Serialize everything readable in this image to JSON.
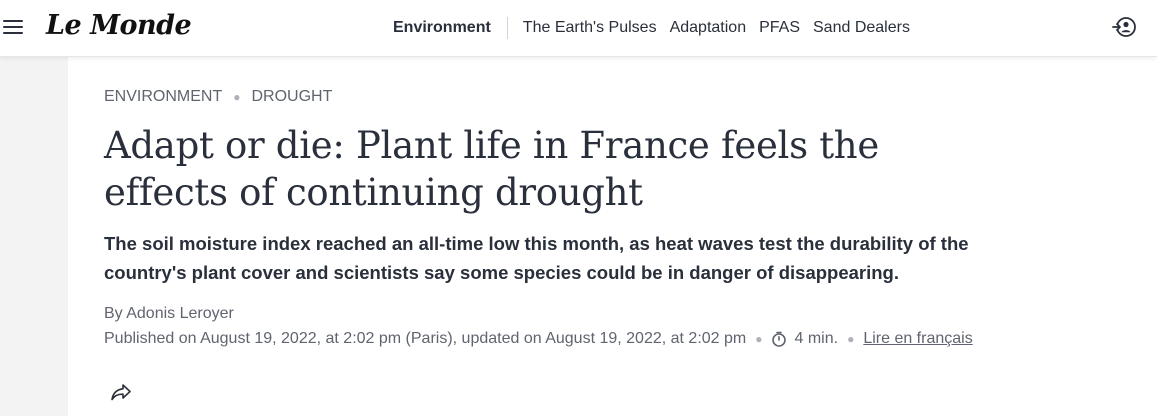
{
  "header": {
    "logo_text": "Le Monde",
    "nav": {
      "active": "Environment",
      "items": [
        "The Earth's Pulses",
        "Adaptation",
        "PFAS",
        "Sand Dealers"
      ]
    },
    "icons": {
      "menu": "hamburger-menu-icon",
      "login": "account-login-icon"
    }
  },
  "article": {
    "breadcrumbs": [
      "ENVIRONMENT",
      "DROUGHT"
    ],
    "title": "Adapt or die: Plant life in France feels the effects of continuing drought",
    "description": "The soil moisture index reached an all-time low this month, as heat waves test the durability of the country's plant cover and scientists say some species could be in danger of disappearing.",
    "author": "By Adonis Leroyer",
    "published": "Published on August 19, 2022, at 2:02 pm (Paris), updated on August 19, 2022, at 2:02 pm",
    "reading_time": "4 min.",
    "french_link": "Lire en français",
    "icons": {
      "clock": "clock-icon",
      "share": "share-icon"
    }
  },
  "colors": {
    "text": "#2a303b",
    "muted": "#5f646e",
    "side_strip": "#f3f3f3"
  }
}
